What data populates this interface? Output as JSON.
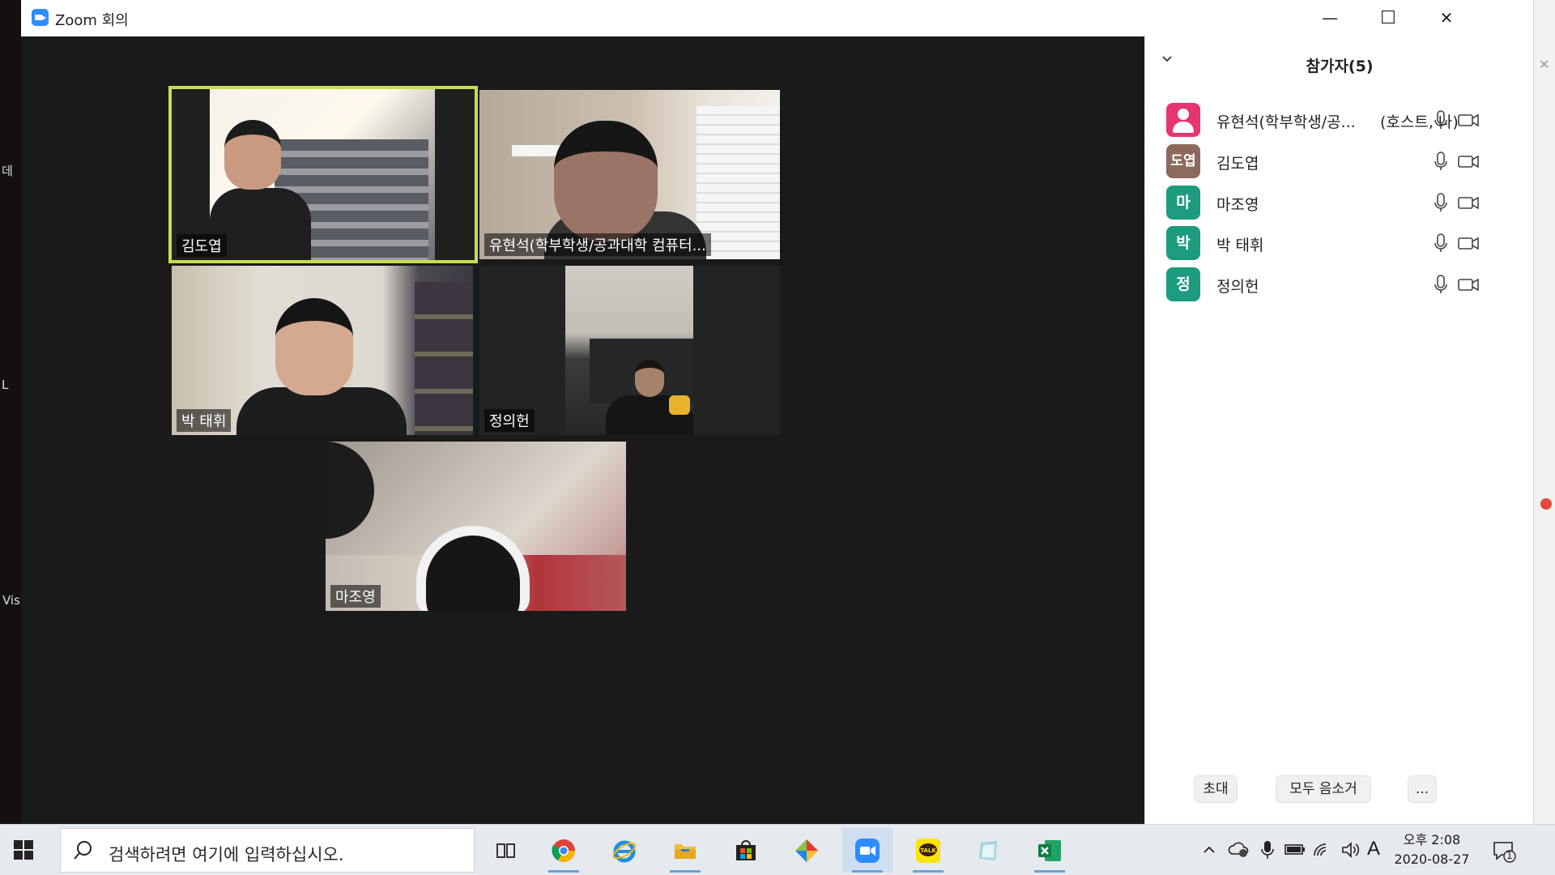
{
  "window": {
    "title": "Zoom 회의",
    "minimize_symbol": "—",
    "maximize_symbol": "☐",
    "close_symbol": "✕"
  },
  "video_tiles": [
    {
      "name": "김도엽",
      "active_speaker": true
    },
    {
      "name": "유현석(학부학생/공과대학 컴퓨터..."
    },
    {
      "name": "박 태휘"
    },
    {
      "name": "정의헌"
    },
    {
      "name": "마조영"
    }
  ],
  "participants_panel": {
    "title": "참가자(5)",
    "collapse_icon": "chevron-down-icon",
    "participants": [
      {
        "avatar": "",
        "name": "유현석(학부학생/공...",
        "tag": "(호스트, 나)",
        "avatar_color": "#e6366f"
      },
      {
        "avatar": "도엽",
        "name": "김도엽",
        "avatar_color": "#8b6a5c"
      },
      {
        "avatar": "마",
        "name": "마조영",
        "avatar_color": "#1c9b7e"
      },
      {
        "avatar": "박",
        "name": "박 태휘",
        "avatar_color": "#1c9b7e"
      },
      {
        "avatar": "정",
        "name": "정의헌",
        "avatar_color": "#1c9b7e"
      }
    ],
    "buttons": {
      "invite": "초대",
      "mute_all": "모두 음소거",
      "more": "..."
    }
  },
  "desktop": {
    "left_fragments": [
      "데",
      "L",
      "Vis"
    ]
  },
  "taskbar": {
    "search_placeholder": "검색하려면 여기에 입력하십시오.",
    "apps": [
      "task-view",
      "chrome",
      "internet-explorer",
      "file-explorer",
      "store",
      "app-diamond",
      "zoom",
      "kakaotalk",
      "notes",
      "excel"
    ],
    "clock": {
      "time": "오후 2:08",
      "date": "2020-08-27"
    },
    "ime": "A",
    "notifications": "1"
  },
  "colors": {
    "active_speaker_border": "#c4e04e",
    "zoom_blue": "#2d8cff"
  }
}
